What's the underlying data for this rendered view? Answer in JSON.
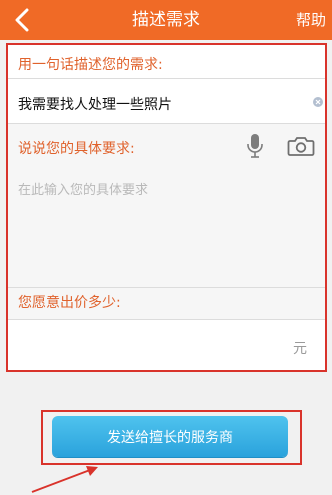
{
  "header": {
    "title": "描述需求",
    "help": "帮助",
    "background": "#f06a26"
  },
  "form": {
    "summary_label": "用一句话描述您的需求:",
    "summary_value": "我需要找人处理一些照片",
    "detail_label": "说说您的具体要求:",
    "detail_placeholder": "在此输入您的具体要求",
    "price_label": "您愿意出价多少:",
    "price_unit": "元",
    "label_color": "#e0622c",
    "icons": [
      "clear-icon",
      "microphone-icon",
      "camera-icon"
    ]
  },
  "actions": {
    "send_label": "发送给擅长的服务商",
    "send_color": "#2aa2dc"
  },
  "annotations": {
    "highlight_color": "#d9332b"
  }
}
